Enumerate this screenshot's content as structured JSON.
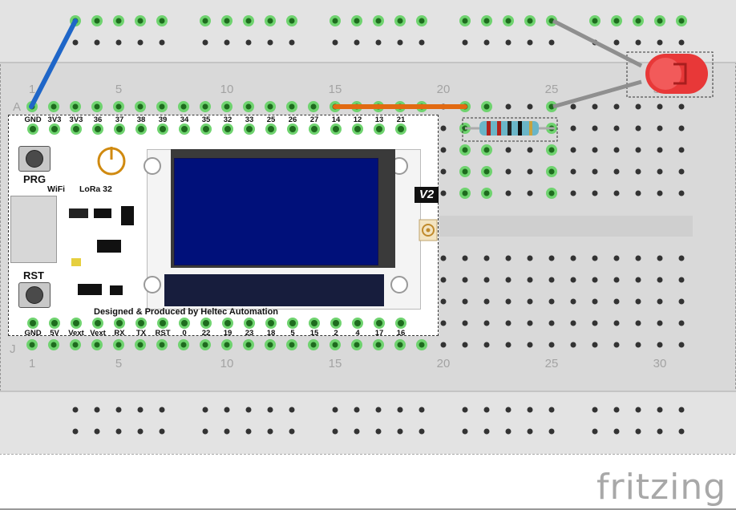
{
  "breadboard": {
    "column_numbers": [
      "1",
      "5",
      "10",
      "15",
      "20",
      "25",
      "30"
    ],
    "row_labels": [
      "A",
      "J"
    ]
  },
  "board": {
    "top_pins": [
      "GND",
      "3V3",
      "3V3",
      "36",
      "37",
      "38",
      "39",
      "34",
      "35",
      "32",
      "33",
      "25",
      "26",
      "27",
      "14",
      "12",
      "13",
      "21"
    ],
    "bottom_pins": [
      "GND",
      "5V",
      "Vext",
      "Vext",
      "RX",
      "TX",
      "RST",
      "0",
      "22",
      "19",
      "23",
      "18",
      "5",
      "15",
      "2",
      "4",
      "17",
      "16"
    ],
    "prg_label": "PRG",
    "rst_label": "RST",
    "wifi_label": "WiFi",
    "lora_label": "LoRa  32",
    "version_label": "V2",
    "credit": "Designed & Produced by Heltec Automation"
  },
  "components": {
    "wire_blue": "blue-jumper-wire",
    "wire_orange": "orange-jumper-wire",
    "resistor": "resistor",
    "led": "red-led"
  },
  "colors": {
    "breadboard": "#d9d9d9",
    "hole": "#333333",
    "hole_connected": "#6fd36f",
    "wire_blue": "#1f66c8",
    "wire_orange": "#e26a12",
    "led": "#e83838",
    "led_leg": "#8f8f8f"
  },
  "footer": {
    "brand": "fritzing"
  }
}
